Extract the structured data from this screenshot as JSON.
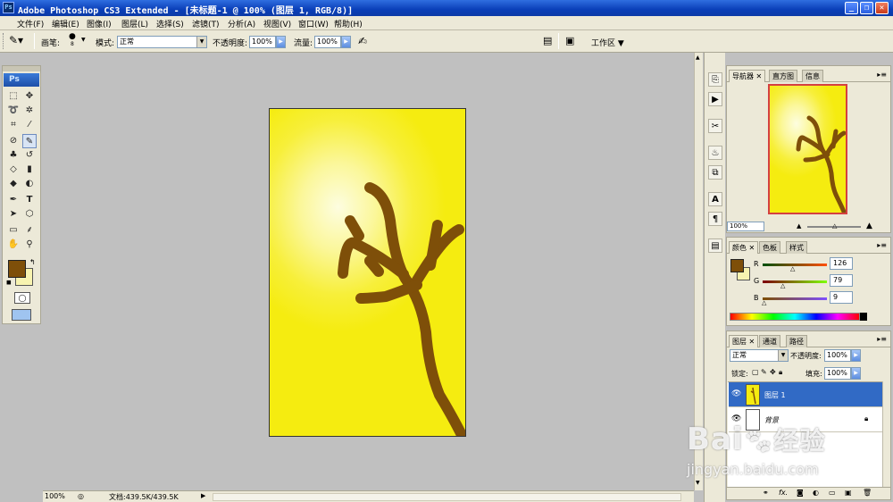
{
  "title_bar": {
    "app_icon": "Ps",
    "title": "Adobe Photoshop CS3 Extended - [未标题-1 @ 100% (图层 1, RGB/8)]",
    "buttons": [
      "minimize-icon",
      "restore-icon",
      "close-icon"
    ]
  },
  "menu": [
    "文件(F)",
    "编辑(E)",
    "图像(I)",
    "图层(L)",
    "选择(S)",
    "滤镜(T)",
    "分析(A)",
    "视图(V)",
    "窗口(W)",
    "帮助(H)"
  ],
  "options_bar": {
    "brush_label": "画笔:",
    "brush_size": "8",
    "mode_label": "模式:",
    "mode_value": "正常",
    "opacity_label": "不透明度:",
    "opacity_value": "100%",
    "flow_label": "流量:",
    "flow_value": "100%",
    "workspace_label": "工作区"
  },
  "toolbox": {
    "logo": "Ps",
    "foreground_color": "#7e4f09",
    "background_color": "#f7f3b0"
  },
  "document": {
    "canvas_gradient_center": "#fdfde0",
    "canvas_gradient_edge": "#f5ec10",
    "branch_color": "#7e4f09"
  },
  "status_bar": {
    "zoom": "100%",
    "doc_info": "文档:439.5K/439.5K"
  },
  "navigator_panel": {
    "tabs": [
      "导航器",
      "直方图",
      "信息"
    ],
    "zoom": "100%"
  },
  "color_panel": {
    "tabs": [
      "颜色",
      "色板",
      "样式"
    ],
    "channels": [
      {
        "label": "R",
        "value": "126",
        "fraction": 0.494
      },
      {
        "label": "G",
        "value": "79",
        "fraction": 0.31
      },
      {
        "label": "B",
        "value": "9",
        "fraction": 0.035
      }
    ]
  },
  "layers_panel": {
    "tabs": [
      "图层",
      "通道",
      "路径"
    ],
    "blend_mode": "正常",
    "opacity_label": "不透明度:",
    "opacity_value": "100%",
    "lock_label": "锁定:",
    "fill_label": "填充:",
    "fill_value": "100%",
    "layers": [
      {
        "name": "图层 1",
        "selected": true
      },
      {
        "name": "背景",
        "selected": false,
        "locked": true
      }
    ],
    "bottom_icons": [
      "link-icon",
      "fx-icon",
      "mask-icon",
      "adjustment-icon",
      "group-icon",
      "new-layer-icon",
      "trash-icon"
    ]
  },
  "watermark": {
    "brand": "Bai",
    "brand_cn": "经验",
    "url": "jingyan.baidu.com"
  }
}
